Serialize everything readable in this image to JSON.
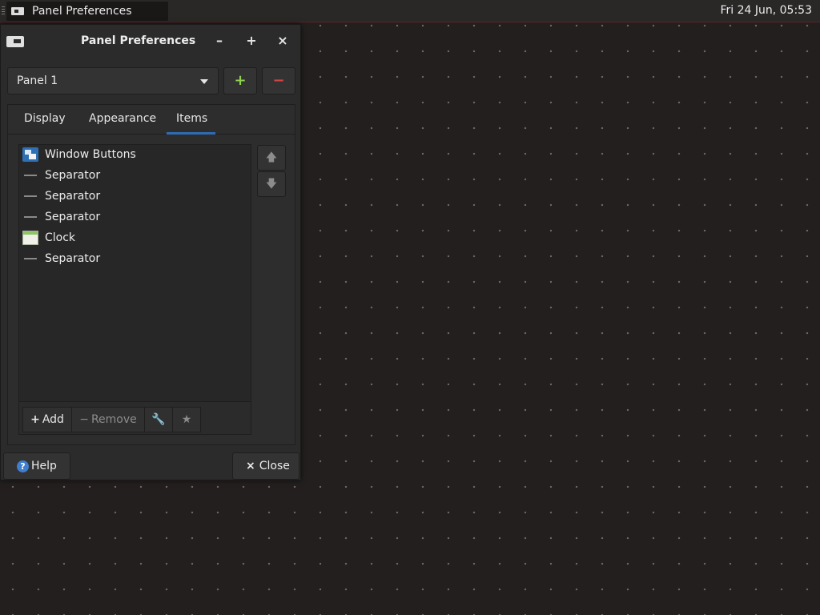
{
  "top_panel": {
    "taskbar_item_label": "Panel Preferences",
    "clock": "Fri 24 Jun, 05:53"
  },
  "dialog": {
    "title": "Panel Preferences",
    "controls": {
      "minimize": "–",
      "maximize": "+",
      "close": "×"
    },
    "panel_selector": {
      "selected": "Panel 1",
      "add_symbol": "+",
      "remove_symbol": "−"
    },
    "tabs": [
      {
        "label": "Display"
      },
      {
        "label": "Appearance"
      },
      {
        "label": "Items",
        "active": true
      }
    ],
    "items": [
      {
        "label": "Window Buttons",
        "icon": "window-buttons-icon"
      },
      {
        "label": "Separator",
        "icon": "separator-icon"
      },
      {
        "label": "Separator",
        "icon": "separator-icon"
      },
      {
        "label": "Separator",
        "icon": "separator-icon"
      },
      {
        "label": "Clock",
        "icon": "clock-icon"
      },
      {
        "label": "Separator",
        "icon": "separator-icon"
      }
    ],
    "item_toolbar": {
      "add_label": "Add",
      "remove_label": "Remove",
      "add_symbol": "+",
      "remove_symbol": "−",
      "settings_symbol": "🔧",
      "about_symbol": "★"
    },
    "move_up_symbol": "🡅",
    "move_down_symbol": "🡇",
    "help_label": "Help",
    "help_symbol": "?",
    "close_label": "Close",
    "close_symbol": "×"
  },
  "colors": {
    "accent": "#2e6bb5",
    "add_green": "#8fd14f",
    "remove_red": "#d04545"
  }
}
